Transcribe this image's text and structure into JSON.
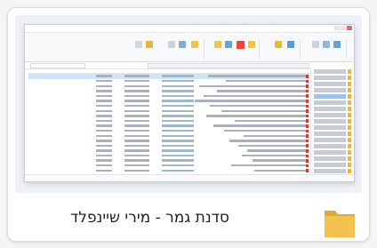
{
  "item": {
    "label": "סדנת גמר - מירי שיינפלד",
    "type_icon": "folder-icon"
  },
  "colors": {
    "folder": "#F2C14E",
    "folder_dark": "#E0A82E",
    "selection": "#CFE3FB",
    "pdf": "#D33333"
  },
  "preview": {
    "description_icon": "file-explorer-window",
    "row_count": 21
  }
}
